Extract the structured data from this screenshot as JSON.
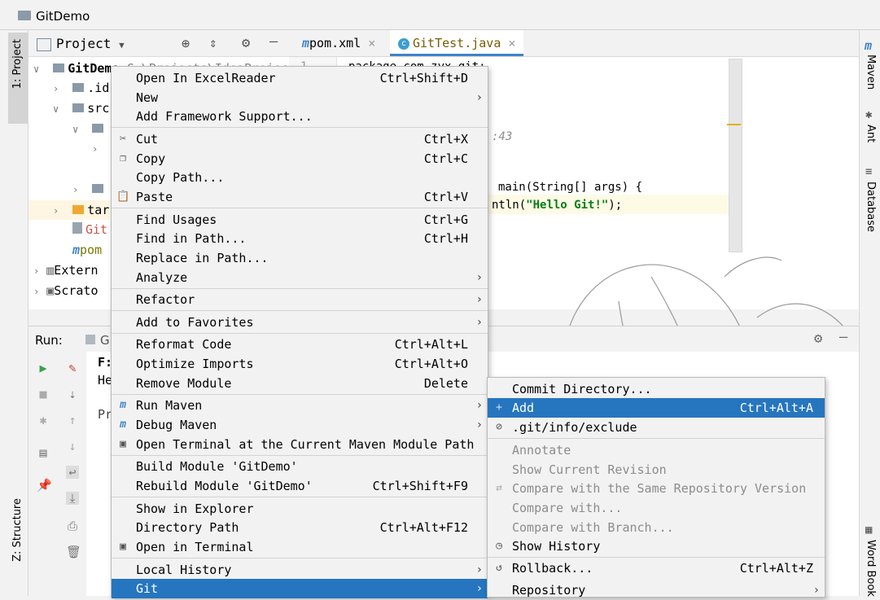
{
  "breadcrumb": {
    "project": "GitDemo"
  },
  "left_stripe": {
    "project_tab": "1: Project",
    "structure_tab": "Z: Structure"
  },
  "right_stripe": {
    "maven": "Maven",
    "ant": "Ant",
    "database": "Database",
    "word_book": "Word Book"
  },
  "project_panel": {
    "title": "Project",
    "tree": [
      {
        "text": "GitDemo",
        "path": "C:\\Projects\\IdeaProjec"
      },
      {
        "text": ".id"
      },
      {
        "text": "src"
      },
      {
        "text": ""
      },
      {
        "text": ""
      },
      {
        "text": ""
      },
      {
        "text": "tar"
      },
      {
        "text": "Git"
      },
      {
        "text": "pom"
      },
      {
        "text": "Extern"
      },
      {
        "text": "Scrato"
      }
    ]
  },
  "editor": {
    "tabs": [
      {
        "label": "pom.xml"
      },
      {
        "label": "GitTest.java"
      }
    ],
    "line_no": "1",
    "code": {
      "line1": "package com.zyx.git;",
      "comment": ":43",
      "main_sig": "main(String[] args) {",
      "print_pre": "ntln(",
      "print_str": "\"Hello Git!\"",
      "print_post": ");"
    }
  },
  "run_panel": {
    "label": "Run:",
    "tab": "G",
    "console": {
      "l1": "F:",
      "l2": "He",
      "l3": "Pr"
    }
  },
  "context_menu": {
    "items": [
      {
        "label": "Open In ExcelReader",
        "shortcut": "Ctrl+Shift+D"
      },
      {
        "label": "New"
      },
      {
        "label": "Add Framework Support..."
      },
      {
        "label": "Cut",
        "shortcut": "Ctrl+X"
      },
      {
        "label": "Copy",
        "shortcut": "Ctrl+C"
      },
      {
        "label": "Copy Path..."
      },
      {
        "label": "Paste",
        "shortcut": "Ctrl+V"
      },
      {
        "label": "Find Usages",
        "shortcut": "Ctrl+G"
      },
      {
        "label": "Find in Path...",
        "shortcut": "Ctrl+H"
      },
      {
        "label": "Replace in Path..."
      },
      {
        "label": "Analyze"
      },
      {
        "label": "Refactor"
      },
      {
        "label": "Add to Favorites"
      },
      {
        "label": "Reformat Code",
        "shortcut": "Ctrl+Alt+L"
      },
      {
        "label": "Optimize Imports",
        "shortcut": "Ctrl+Alt+O"
      },
      {
        "label": "Remove Module",
        "shortcut": "Delete"
      },
      {
        "label": "Run Maven"
      },
      {
        "label": "Debug Maven"
      },
      {
        "label": "Open Terminal at the Current Maven Module Path"
      },
      {
        "label": "Build Module 'GitDemo'"
      },
      {
        "label": "Rebuild Module 'GitDemo'",
        "shortcut": "Ctrl+Shift+F9"
      },
      {
        "label": "Show in Explorer"
      },
      {
        "label": "Directory Path",
        "shortcut": "Ctrl+Alt+F12"
      },
      {
        "label": "Open in Terminal"
      },
      {
        "label": "Local History"
      },
      {
        "label": "Git"
      }
    ]
  },
  "git_submenu": {
    "items": [
      {
        "label": "Commit Directory..."
      },
      {
        "label": "Add",
        "shortcut": "Ctrl+Alt+A"
      },
      {
        "label": ".git/info/exclude"
      },
      {
        "label": "Annotate"
      },
      {
        "label": "Show Current Revision"
      },
      {
        "label": "Compare with the Same Repository Version"
      },
      {
        "label": "Compare with..."
      },
      {
        "label": "Compare with Branch..."
      },
      {
        "label": "Show History"
      },
      {
        "label": "Rollback...",
        "shortcut": "Ctrl+Alt+Z"
      },
      {
        "label": "Repository"
      }
    ]
  },
  "colors": {
    "selection": "#2675bf",
    "accent": "#4083c9"
  }
}
